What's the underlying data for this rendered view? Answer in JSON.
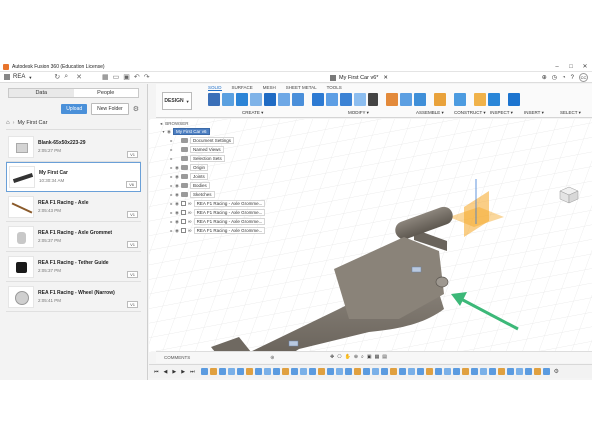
{
  "window": {
    "title": "Autodesk Fusion 360 (Education License)",
    "buttons": [
      "–",
      "□",
      "✕"
    ]
  },
  "topbar": {
    "hub_name": "REA",
    "document_title": "My First Car v6*",
    "icons": [
      "grid-icon",
      "folder-icon",
      "save-icon",
      "undo-icon",
      "redo-icon",
      "plus-icon",
      "clock-icon",
      "bell-icon",
      "help-icon"
    ],
    "avatar_initials": "CC"
  },
  "data_panel": {
    "tabs": [
      "Data",
      "People"
    ],
    "active_tab": "Data",
    "upload_label": "Upload",
    "new_folder_label": "New Folder",
    "breadcrumb": "My First Car",
    "files": [
      {
        "name": "Blank-65x50x223-29",
        "time": "2:05:27 PM",
        "version": "V1",
        "thumb": "block",
        "selected": false
      },
      {
        "name": "My First Car",
        "time": "10:30:34 AM",
        "version": "V6",
        "thumb": "car",
        "selected": true
      },
      {
        "name": "REA F1 Racing - Axle",
        "time": "2:05:43 PM",
        "version": "V1",
        "thumb": "axle",
        "selected": false
      },
      {
        "name": "REA F1 Racing - Axle Grommet",
        "time": "2:05:37 PM",
        "version": "V1",
        "thumb": "grommet",
        "selected": false
      },
      {
        "name": "REA F1 Racing - Tether Guide",
        "time": "2:05:37 PM",
        "version": "V1",
        "thumb": "tether",
        "selected": false
      },
      {
        "name": "REA F1 Racing - Wheel (Narrow)",
        "time": "2:05:41 PM",
        "version": "V1",
        "thumb": "wheel",
        "selected": false
      }
    ]
  },
  "toolbar": {
    "design_label": "DESIGN",
    "tabs": [
      "SOLID",
      "SURFACE",
      "MESH",
      "SHEET METAL",
      "TOOLS"
    ],
    "active_tab": "SOLID",
    "groups": [
      "CREATE ▾",
      "MODIFY ▾",
      "ASSEMBLE ▾",
      "CONSTRUCT ▾",
      "INSPECT ▾",
      "INSERT ▾",
      "SELECT ▾"
    ]
  },
  "browser": {
    "header": "BROWSER",
    "root": "My First Car v6",
    "items": [
      {
        "label": "Document Settings",
        "kind": "folder"
      },
      {
        "label": "Named Views",
        "kind": "folder"
      },
      {
        "label": "Selection Sets",
        "kind": "folder"
      },
      {
        "label": "Origin",
        "kind": "folder"
      },
      {
        "label": "Joints",
        "kind": "folder"
      },
      {
        "label": "Bodies",
        "kind": "folder"
      },
      {
        "label": "Sketches",
        "kind": "folder"
      },
      {
        "label": "REA F1 Racing - Axle Gromme...",
        "kind": "link"
      },
      {
        "label": "REA F1 Racing - Axle Gromme...",
        "kind": "link"
      },
      {
        "label": "REA F1 Racing - Axle Gromme...",
        "kind": "link"
      },
      {
        "label": "REA F1 Racing - Axle Gromme...",
        "kind": "link"
      }
    ]
  },
  "comments": {
    "label": "COMMENTS"
  },
  "colors": {
    "accent": "#1e6fc9",
    "model": "#7a736a",
    "arrow": "#3cb878",
    "origin_plane": "#f5a623"
  }
}
